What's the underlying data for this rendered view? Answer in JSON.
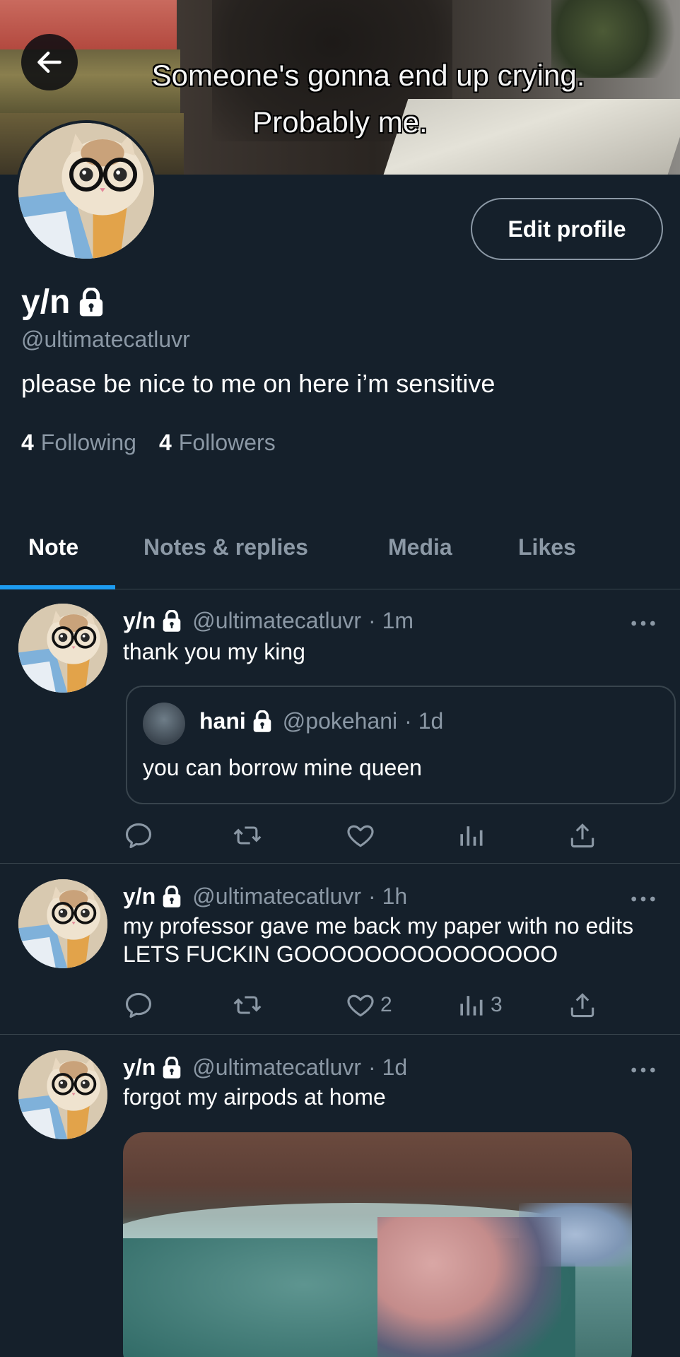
{
  "header": {
    "back_label": "Back",
    "banner_caption_line1": "Someone's gonna end up crying.",
    "banner_caption_line2": "Probably me."
  },
  "profile": {
    "display_name": "y/n",
    "handle": "@ultimatecatluvr",
    "bio": "please be nice to me on here i’m sensitive",
    "following_count": "4",
    "following_label": "Following",
    "followers_count": "4",
    "followers_label": "Followers",
    "edit_button_label": "Edit profile",
    "protected": true
  },
  "tabs": [
    {
      "label": "Note",
      "active": true
    },
    {
      "label": "Notes & replies",
      "active": false
    },
    {
      "label": "Media",
      "active": false
    },
    {
      "label": "Likes",
      "active": false
    }
  ],
  "tweets": [
    {
      "name": "y/n",
      "handle": "@ultimatecatluvr",
      "time": "· 1m",
      "text": "thank you my king",
      "quote": {
        "name": "hani",
        "handle": "@pokehani",
        "time": "· 1d",
        "text": "you can borrow mine queen"
      },
      "likes": "",
      "views": ""
    },
    {
      "name": "y/n",
      "handle": "@ultimatecatluvr",
      "time": "· 1h",
      "text": "my professor gave me back my paper with no edits LETS FUCKIN GOOOOOOOOOOOOOOO",
      "likes": "2",
      "views": "3"
    },
    {
      "name": "y/n",
      "handle": "@ultimatecatluvr",
      "time": "· 1d",
      "text": "forgot my airpods at home",
      "has_media": true
    }
  ],
  "icons": {
    "back": "arrow-left-icon",
    "lock": "lock-icon",
    "more": "more-horizontal-icon",
    "reply": "reply-icon",
    "retweet": "retweet-icon",
    "like": "heart-icon",
    "views": "views-icon",
    "share": "share-icon"
  },
  "colors": {
    "background": "#15202b",
    "secondary_text": "#8b98a5",
    "accent": "#1d9bf0",
    "border": "#38444d"
  }
}
